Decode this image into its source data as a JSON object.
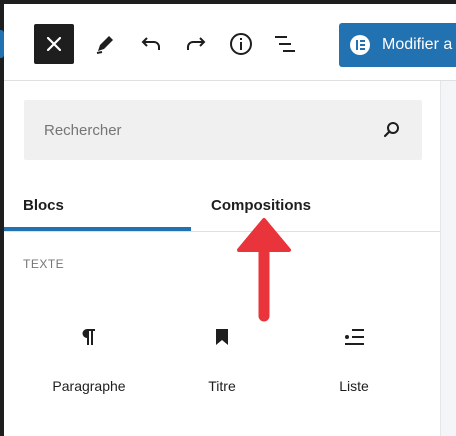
{
  "toolbar": {
    "modifier_label": "Modifier a"
  },
  "search": {
    "placeholder": "Rechercher"
  },
  "tabs": [
    {
      "label": "Blocs",
      "active": true
    },
    {
      "label": "Compositions",
      "active": false
    }
  ],
  "section": {
    "title": "TEXTE"
  },
  "blocks": [
    {
      "label": "Paragraphe",
      "icon": "paragraph-icon"
    },
    {
      "label": "Titre",
      "icon": "bookmark-heading-icon"
    },
    {
      "label": "Liste",
      "icon": "list-icon"
    }
  ],
  "colors": {
    "accent": "#2271b1",
    "annotation_arrow": "#e8343a",
    "dark": "#1e1e1e"
  }
}
